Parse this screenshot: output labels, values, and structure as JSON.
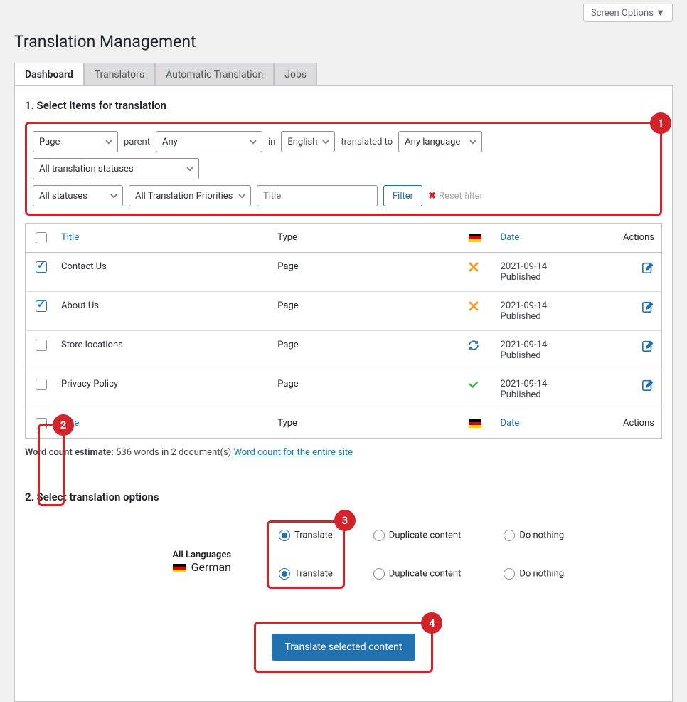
{
  "header": {
    "screen_options": "Screen Options ▼",
    "title": "Translation Management"
  },
  "tabs": {
    "dashboard": "Dashboard",
    "translators": "Translators",
    "automatic": "Automatic Translation",
    "jobs": "Jobs"
  },
  "step1": {
    "heading": "1. Select items for translation",
    "badge": "1",
    "filter": {
      "type": "Page",
      "parent_label": "parent",
      "parent": "Any",
      "in_label": "in",
      "language": "English",
      "translated_to_label": "translated to",
      "translated_to": "Any language",
      "translation_status": "All translation statuses",
      "statuses": "All statuses",
      "priorities": "All Translation Priorities",
      "title_placeholder": "Title",
      "filter_button": "Filter",
      "reset": "Reset filter"
    },
    "table": {
      "headers": {
        "title": "Title",
        "type": "Type",
        "date": "Date",
        "actions": "Actions"
      },
      "rows": [
        {
          "checked": true,
          "title": "Contact Us",
          "type": "Page",
          "status": "not-translated",
          "date": "2021-09-14",
          "state": "Published"
        },
        {
          "checked": true,
          "title": "About Us",
          "type": "Page",
          "status": "not-translated",
          "date": "2021-09-14",
          "state": "Published"
        },
        {
          "checked": false,
          "title": "Store locations",
          "type": "Page",
          "status": "in-progress",
          "date": "2021-09-14",
          "state": "Published"
        },
        {
          "checked": false,
          "title": "Privacy Policy",
          "type": "Page",
          "status": "translated",
          "date": "2021-09-14",
          "state": "Published"
        }
      ],
      "badge": "2"
    },
    "word_count": {
      "label": "Word count estimate:",
      "text": "536 words in 2 document(s)",
      "link": "Word count for the entire site"
    }
  },
  "step2": {
    "heading": "2. Select translation options",
    "all_languages": "All Languages",
    "german": "German",
    "translate": "Translate",
    "duplicate": "Duplicate content",
    "nothing": "Do nothing",
    "badge": "3",
    "submit": "Translate selected content",
    "submit_badge": "4"
  }
}
